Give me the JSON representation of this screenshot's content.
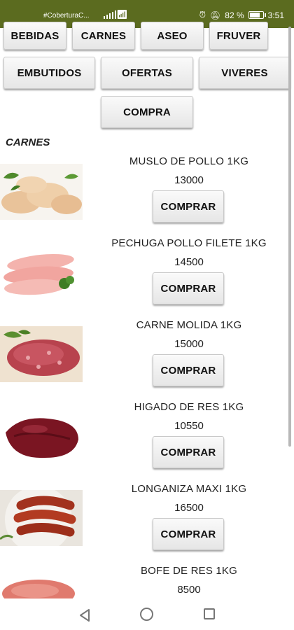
{
  "status": {
    "carrier": "#CoberturaC...",
    "battery_percent": "82 %",
    "battery_level": 0.82,
    "time": "3:51"
  },
  "categories": {
    "bebidas": "BEBIDAS",
    "carnes": "CARNES",
    "aseo": "ASEO",
    "fruver": "FRUVER",
    "embutidos": "EMBUTIDOS",
    "ofertas": "OFERTAS",
    "viveres": "VIVERES",
    "compra": "COMPRA"
  },
  "section_title": "CARNES",
  "buy_label": "COMPRAR",
  "products": [
    {
      "name": "MUSLO DE POLLO 1KG",
      "price": "13000",
      "image": "chicken-thigh-image"
    },
    {
      "name": "PECHUGA POLLO FILETE 1KG",
      "price": "14500",
      "image": "chicken-breast-image"
    },
    {
      "name": "CARNE MOLIDA 1KG",
      "price": "15000",
      "image": "ground-beef-image"
    },
    {
      "name": "HIGADO DE RES 1KG",
      "price": "10550",
      "image": "beef-liver-image"
    },
    {
      "name": "LONGANIZA MAXI 1KG",
      "price": "16500",
      "image": "sausage-image"
    },
    {
      "name": "BOFE DE RES 1KG",
      "price": "8500",
      "image": "beef-lung-image"
    }
  ],
  "colors": {
    "status_bar": "#5b6b1f",
    "button_face": "#efefef"
  }
}
